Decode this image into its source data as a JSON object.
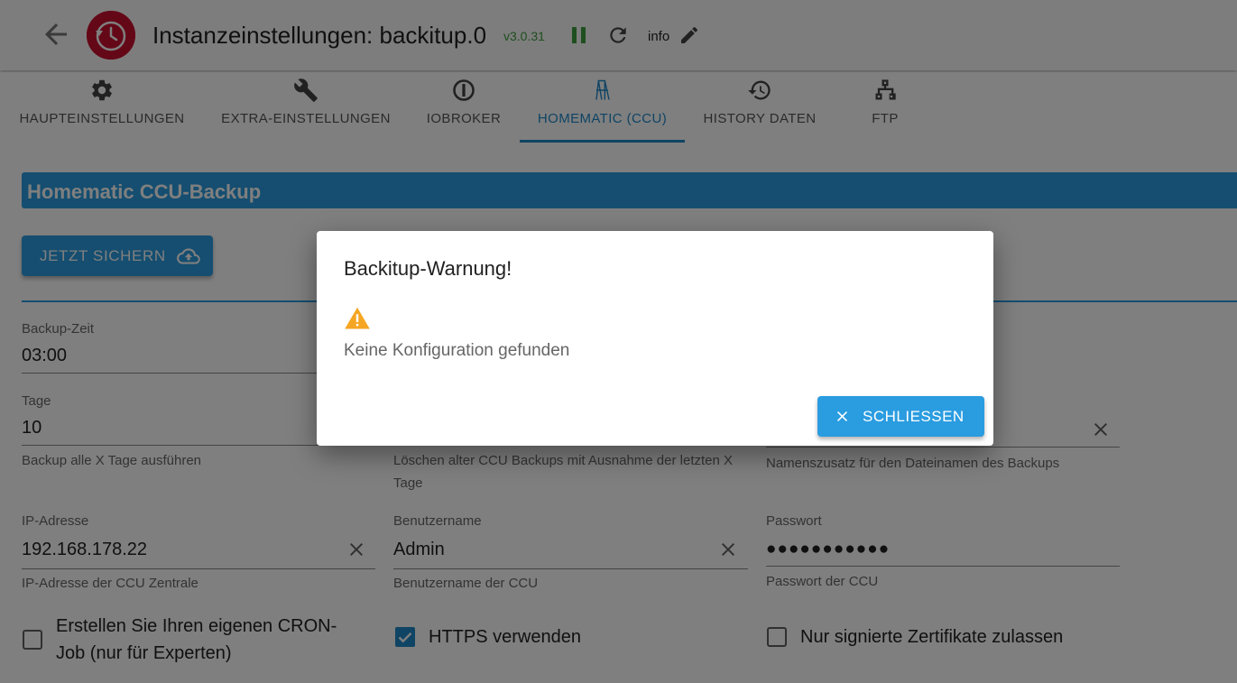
{
  "header": {
    "title": "Instanzeinstellungen: backitup.0",
    "version": "v3.0.31",
    "log_level": "info",
    "icons": {
      "back": "arrow-left-icon",
      "logo": "backitup-logo",
      "pause": "pause-icon",
      "reload": "reload-icon",
      "edit": "pencil-icon"
    },
    "colors": {
      "logo": "#c8102e",
      "version": "#3e9e3e"
    }
  },
  "tabs": [
    {
      "label": "HAUPTEINSTELLUNGEN",
      "icon": "gear-icon"
    },
    {
      "label": "EXTRA-EINSTELLUNGEN",
      "icon": "wrench-icon"
    },
    {
      "label": "IOBROKER",
      "icon": "iobroker-icon"
    },
    {
      "label": "HOMEMATIC (CCU)",
      "icon": "homematic-icon",
      "active": true
    },
    {
      "label": "HISTORY DATEN",
      "icon": "history-icon"
    },
    {
      "label": "FTP",
      "icon": "network-icon"
    }
  ],
  "section": {
    "title": "Homematic CCU-Backup",
    "backup_button": "JETZT SICHERN",
    "accent": "#2a9ce0"
  },
  "fields": {
    "backup_time": {
      "label": "Backup-Zeit",
      "value": "03:00"
    },
    "days": {
      "label": "Tage",
      "value": "10",
      "help": "Backup alle X Tage ausführen"
    },
    "delete_help": "Löschen alter CCU Backups mit Ausnahme der letzten X Tage",
    "name_suffix_help": "Namenszusatz für den Dateinamen des Backups",
    "ip": {
      "label": "IP-Adresse",
      "value": "192.168.178.22",
      "help": "IP-Adresse der CCU Zentrale"
    },
    "username": {
      "label": "Benutzername",
      "value": "Admin",
      "help": "Benutzername der CCU"
    },
    "password": {
      "label": "Passwort",
      "value": "●●●●●●●●●●●",
      "help": "Passwort der CCU"
    }
  },
  "checkboxes": {
    "cron": {
      "label": "Erstellen Sie Ihren eigenen CRON-Job (nur für Experten)",
      "checked": false
    },
    "https": {
      "label": "HTTPS verwenden",
      "checked": true
    },
    "signed_certs": {
      "label": "Nur signierte Zertifikate zulassen",
      "checked": false
    }
  },
  "dialog": {
    "title": "Backitup-Warnung!",
    "icon": "warning-icon",
    "message": "Keine Konfiguration gefunden",
    "close_button": "SCHLIESSEN",
    "warning_color": "#f5a623"
  }
}
